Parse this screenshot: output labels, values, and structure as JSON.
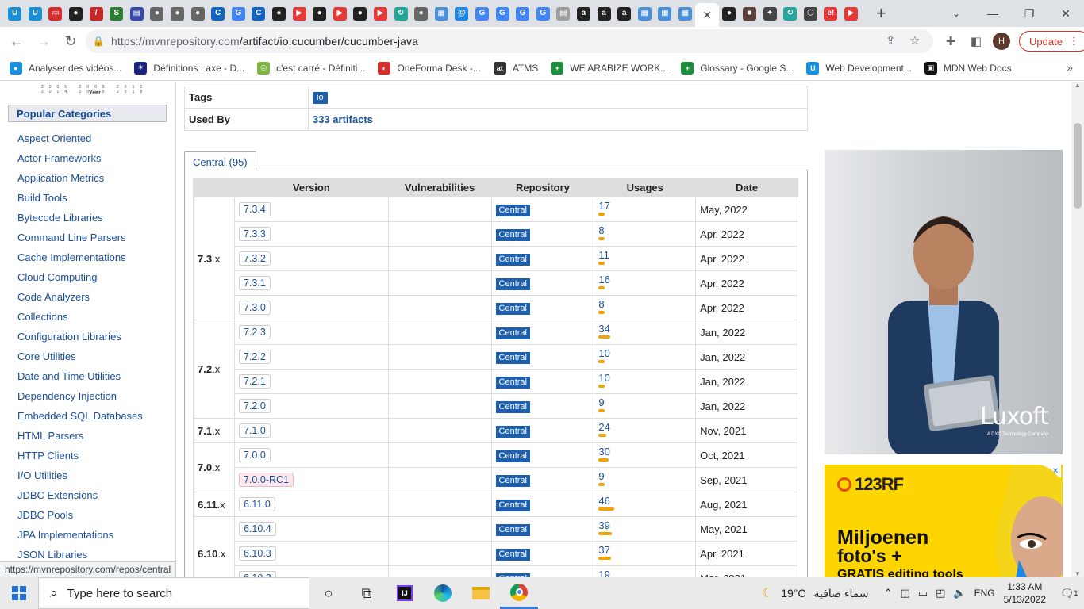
{
  "browser": {
    "tabs": [
      {
        "icon": "u-icon",
        "color": "#1a8fd9",
        "g": "U"
      },
      {
        "icon": "u-icon",
        "color": "#1a8fd9",
        "g": "U"
      },
      {
        "icon": "tv-icon",
        "color": "#d32f2f",
        "g": "▭"
      },
      {
        "icon": "github-icon",
        "color": "#222",
        "g": "●"
      },
      {
        "icon": "pen-icon",
        "color": "#c62828",
        "g": "/"
      },
      {
        "icon": "sheet-icon",
        "color": "#2e7d32",
        "g": "S"
      },
      {
        "icon": "doc-icon",
        "color": "#3949ab",
        "g": "▤"
      },
      {
        "icon": "globe-icon",
        "color": "#666",
        "g": "●"
      },
      {
        "icon": "globe-icon",
        "color": "#666",
        "g": "●"
      },
      {
        "icon": "globe-icon",
        "color": "#666",
        "g": "●"
      },
      {
        "icon": "c-icon",
        "color": "#1565c0",
        "g": "C"
      },
      {
        "icon": "google-icon",
        "color": "#4285f4",
        "g": "G"
      },
      {
        "icon": "c-icon",
        "color": "#1565c0",
        "g": "C"
      },
      {
        "icon": "github-icon",
        "color": "#222",
        "g": "●"
      },
      {
        "icon": "youtube-icon",
        "color": "#e53935",
        "g": "▶"
      },
      {
        "icon": "github-icon",
        "color": "#222",
        "g": "●"
      },
      {
        "icon": "youtube-icon",
        "color": "#e53935",
        "g": "▶"
      },
      {
        "icon": "github-icon",
        "color": "#222",
        "g": "●"
      },
      {
        "icon": "youtube-icon",
        "color": "#e53935",
        "g": "▶"
      },
      {
        "icon": "arrow-icon",
        "color": "#26a69a",
        "g": "↻"
      },
      {
        "icon": "globe-icon",
        "color": "#666",
        "g": "●"
      },
      {
        "icon": "grid-icon",
        "color": "#4a90d9",
        "g": "▦"
      },
      {
        "icon": "at-icon",
        "color": "#1e88e5",
        "g": "@"
      },
      {
        "icon": "google-icon",
        "color": "#4285f4",
        "g": "G"
      },
      {
        "icon": "google-icon",
        "color": "#4285f4",
        "g": "G"
      },
      {
        "icon": "google-icon",
        "color": "#4285f4",
        "g": "G"
      },
      {
        "icon": "google-icon",
        "color": "#4285f4",
        "g": "G"
      },
      {
        "icon": "page-icon",
        "color": "#9e9e9e",
        "g": "▤"
      },
      {
        "icon": "amazon-icon",
        "color": "#222",
        "g": "a"
      },
      {
        "icon": "amazon-icon",
        "color": "#222",
        "g": "a"
      },
      {
        "icon": "amazon-icon",
        "color": "#222",
        "g": "a"
      },
      {
        "icon": "grid-icon",
        "color": "#4a90d9",
        "g": "▦"
      },
      {
        "icon": "grid-icon",
        "color": "#4a90d9",
        "g": "▦"
      },
      {
        "icon": "grid-icon",
        "color": "#4a90d9",
        "g": "▦"
      }
    ],
    "active_tab_glyph": "✕",
    "tabs_after": [
      {
        "icon": "github-icon",
        "color": "#222",
        "g": "●"
      },
      {
        "icon": "box-icon",
        "color": "#5d4037",
        "g": "■"
      },
      {
        "icon": "star-icon",
        "color": "#444",
        "g": "✦"
      },
      {
        "icon": "arrow-icon",
        "color": "#26a69a",
        "g": "↻"
      },
      {
        "icon": "shield-icon",
        "color": "#444",
        "g": "⬡"
      },
      {
        "icon": "e-icon",
        "color": "#e53935",
        "g": "e!"
      },
      {
        "icon": "youtube-icon",
        "color": "#e53935",
        "g": "▶"
      }
    ],
    "url_host": "https://mvnrepository.com",
    "url_path": "/artifact/io.cucumber/cucumber-java",
    "avatar_letter": "H",
    "update_label": "Update",
    "bookmarks": [
      {
        "label": "Analyser des vidéos...",
        "color": "#1a8fd9",
        "g": "●"
      },
      {
        "label": "Définitions : axe - D...",
        "color": "#1a237e",
        "g": "✶"
      },
      {
        "label": "c'est carré - Définiti...",
        "color": "#7cb342",
        "g": "◎"
      },
      {
        "label": "OneForma Desk -...",
        "color": "#d32f2f",
        "g": "◐"
      },
      {
        "label": "ATMS",
        "color": "#333",
        "g": "at"
      },
      {
        "label": "WE ARABIZE WORK...",
        "color": "#1e8e3e",
        "g": "+"
      },
      {
        "label": "Glossary - Google S...",
        "color": "#1e8e3e",
        "g": "+"
      },
      {
        "label": "Web Development...",
        "color": "#1a8fd9",
        "g": "U"
      },
      {
        "label": "MDN Web Docs",
        "color": "#111",
        "g": "▣"
      }
    ],
    "status_url": "https://mvnrepository.com/repos/central"
  },
  "sidebar": {
    "chart_ticks": "2005 2008 2012 2014 2016 2018",
    "chart_year_label": "Year",
    "heading": "Popular Categories",
    "categories": [
      "Aspect Oriented",
      "Actor Frameworks",
      "Application Metrics",
      "Build Tools",
      "Bytecode Libraries",
      "Command Line Parsers",
      "Cache Implementations",
      "Cloud Computing",
      "Code Analyzers",
      "Collections",
      "Configuration Libraries",
      "Core Utilities",
      "Date and Time Utilities",
      "Dependency Injection",
      "Embedded SQL Databases",
      "HTML Parsers",
      "HTTP Clients",
      "I/O Utilities",
      "JDBC Extensions",
      "JDBC Pools",
      "JPA Implementations",
      "JSON Libraries"
    ]
  },
  "info": {
    "tags_label": "Tags",
    "tags_value": "io",
    "used_by_label": "Used By",
    "used_by_value": "333 artifacts"
  },
  "versions": {
    "tab_label": "Central (95)",
    "columns": [
      "Version",
      "Vulnerabilities",
      "Repository",
      "Usages",
      "Date"
    ],
    "groups": [
      {
        "name": "7.3",
        "suffix": ".x",
        "rows": [
          {
            "version": "7.3.4",
            "repo": "Central",
            "usages": "17",
            "usage_frac": 0.37,
            "date": "May, 2022"
          },
          {
            "version": "7.3.3",
            "repo": "Central",
            "usages": "8",
            "usage_frac": 0.17,
            "date": "Apr, 2022"
          },
          {
            "version": "7.3.2",
            "repo": "Central",
            "usages": "11",
            "usage_frac": 0.24,
            "date": "Apr, 2022"
          },
          {
            "version": "7.3.1",
            "repo": "Central",
            "usages": "16",
            "usage_frac": 0.35,
            "date": "Apr, 2022"
          },
          {
            "version": "7.3.0",
            "repo": "Central",
            "usages": "8",
            "usage_frac": 0.17,
            "date": "Apr, 2022"
          }
        ]
      },
      {
        "name": "7.2",
        "suffix": ".x",
        "rows": [
          {
            "version": "7.2.3",
            "repo": "Central",
            "usages": "34",
            "usage_frac": 0.74,
            "date": "Jan, 2022"
          },
          {
            "version": "7.2.2",
            "repo": "Central",
            "usages": "10",
            "usage_frac": 0.22,
            "date": "Jan, 2022"
          },
          {
            "version": "7.2.1",
            "repo": "Central",
            "usages": "10",
            "usage_frac": 0.22,
            "date": "Jan, 2022"
          },
          {
            "version": "7.2.0",
            "repo": "Central",
            "usages": "9",
            "usage_frac": 0.2,
            "date": "Jan, 2022"
          }
        ]
      },
      {
        "name": "7.1",
        "suffix": ".x",
        "rows": [
          {
            "version": "7.1.0",
            "repo": "Central",
            "usages": "24",
            "usage_frac": 0.52,
            "date": "Nov, 2021"
          }
        ]
      },
      {
        "name": "7.0",
        "suffix": ".x",
        "rows": [
          {
            "version": "7.0.0",
            "repo": "Central",
            "usages": "30",
            "usage_frac": 0.65,
            "date": "Oct, 2021"
          },
          {
            "version": "7.0.0-RC1",
            "repo": "Central",
            "usages": "9",
            "usage_frac": 0.2,
            "date": "Sep, 2021",
            "rc": true
          }
        ]
      },
      {
        "name": "6.11",
        "suffix": ".x",
        "rows": [
          {
            "version": "6.11.0",
            "repo": "Central",
            "usages": "46",
            "usage_frac": 1.0,
            "date": "Aug, 2021"
          }
        ]
      },
      {
        "name": "6.10",
        "suffix": ".x",
        "rows": [
          {
            "version": "6.10.4",
            "repo": "Central",
            "usages": "39",
            "usage_frac": 0.85,
            "date": "May, 2021"
          },
          {
            "version": "6.10.3",
            "repo": "Central",
            "usages": "37",
            "usage_frac": 0.8,
            "date": "Apr, 2021"
          },
          {
            "version": "6.10.2",
            "repo": "Central",
            "usages": "19",
            "usage_frac": 0.41,
            "date": "Mar, 2021"
          }
        ]
      }
    ]
  },
  "ads": {
    "luxoft_brand": "Luxoft",
    "luxoft_sub": "A DXC Technology Company",
    "rf_brand": "123RF",
    "rf_line1": "Miljoenen",
    "rf_line2": "foto's +",
    "rf_line3": "GRATIS editing tools"
  },
  "taskbar": {
    "search_placeholder": "Type here to search",
    "weather_temp": "19°C",
    "weather_desc": "سماء صافية",
    "language": "ENG",
    "time": "1:33 AM",
    "date": "5/13/2022",
    "notification_count": "1"
  },
  "colors": {
    "link": "#1a4f9c",
    "repo_badge": "#1d5fad",
    "usage_bar": "#f0a30a"
  }
}
